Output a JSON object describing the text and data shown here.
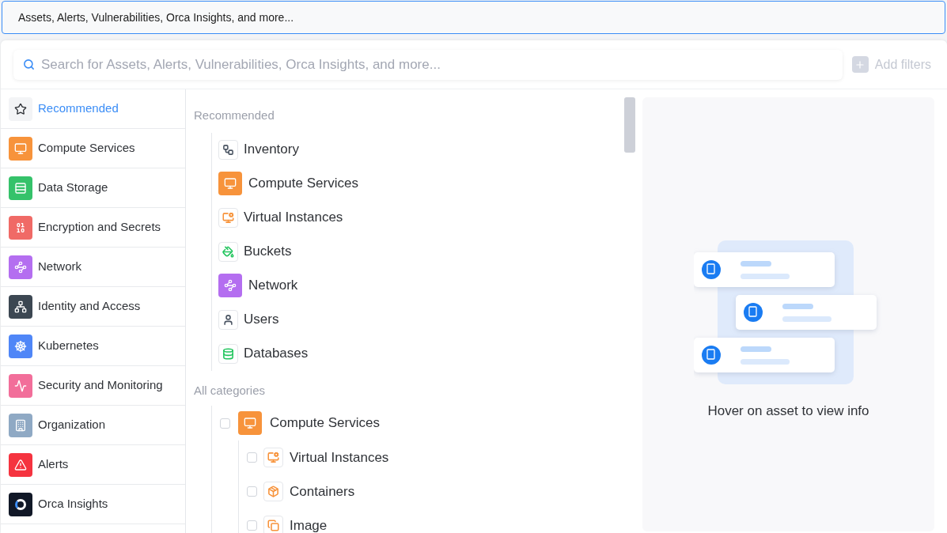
{
  "query_bar": {
    "value": "Assets, Alerts, Vulnerabilities, Orca Insights, and more..."
  },
  "search": {
    "placeholder": "Search for Assets, Alerts, Vulnerabilities, Orca Insights, and more...",
    "add_filters": {
      "label": "Add filters",
      "disabled": true
    }
  },
  "sidebar": {
    "items": [
      {
        "label": "Recommended",
        "selected": true,
        "color": "#f3f4f6"
      },
      {
        "label": "Compute Services",
        "selected": false,
        "color": "#f7933b"
      },
      {
        "label": "Data Storage",
        "selected": false,
        "color": "#35c26a"
      },
      {
        "label": "Encryption and Secrets",
        "selected": false,
        "color": "#f06a66"
      },
      {
        "label": "Network",
        "selected": false,
        "color": "#b46ef0"
      },
      {
        "label": "Identity and Access",
        "selected": false,
        "color": "#3c4752"
      },
      {
        "label": "Kubernetes",
        "selected": false,
        "color": "#4f86f7"
      },
      {
        "label": "Security and Monitoring",
        "selected": false,
        "color": "#f26e9a"
      },
      {
        "label": "Organization",
        "selected": false,
        "color": "#8fa9c4"
      },
      {
        "label": "Alerts",
        "selected": false,
        "color": "#f5333f"
      },
      {
        "label": "Orca Insights",
        "selected": false,
        "color": "#111827"
      }
    ]
  },
  "recommended": {
    "heading": "Recommended",
    "items": [
      {
        "label": "Inventory",
        "filled": false,
        "color": "#4b5563"
      },
      {
        "label": "Compute Services",
        "filled": true,
        "color": "#f7933b"
      },
      {
        "label": "Virtual Instances",
        "filled": false,
        "color": "#f7933b"
      },
      {
        "label": "Buckets",
        "filled": false,
        "color": "#22c55e"
      },
      {
        "label": "Network",
        "filled": true,
        "color": "#b46ef0"
      },
      {
        "label": "Users",
        "filled": false,
        "color": "#4b5563"
      },
      {
        "label": "Databases",
        "filled": false,
        "color": "#22c55e"
      }
    ]
  },
  "all_categories": {
    "heading": "All categories",
    "items": [
      {
        "label": "Compute Services",
        "checked": false,
        "filled": true,
        "color": "#f7933b",
        "children": [
          {
            "label": "Virtual Instances",
            "checked": false,
            "filled": false,
            "color": "#f7933b"
          },
          {
            "label": "Containers",
            "checked": false,
            "filled": false,
            "color": "#f7933b"
          },
          {
            "label": "Image",
            "checked": false,
            "filled": false,
            "color": "#f7933b"
          }
        ]
      }
    ]
  },
  "preview": {
    "message": "Hover on asset to view info"
  }
}
